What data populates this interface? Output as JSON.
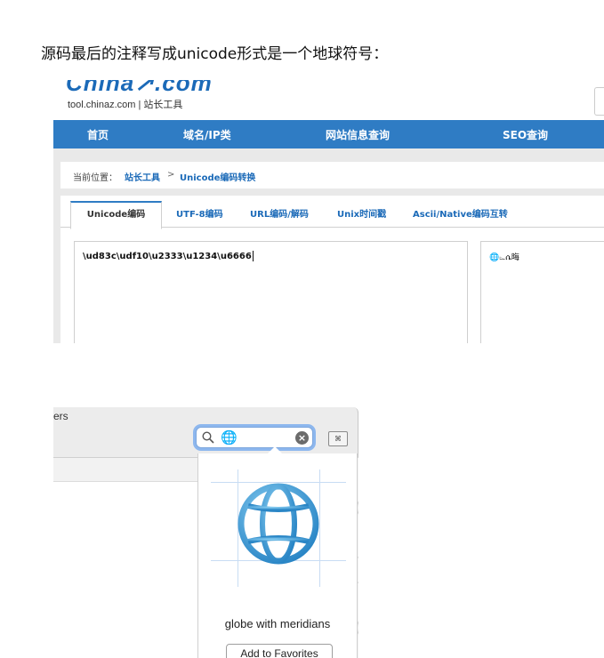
{
  "caption": "源码最后的注释写成unicode形式是一个地球符号：",
  "site": {
    "logo_text": "China↗.com",
    "logo_sub": "tool.chinaz.com | 站长工具",
    "nav": [
      "首页",
      "域名/IP类",
      "网站信息查询",
      "SEO查询"
    ],
    "breadcrumb": {
      "label": "当前位置：",
      "link1": "站长工具",
      "separator": ">",
      "link2": "Unicode编码转换"
    },
    "tabs": [
      {
        "label": "Unicode编码",
        "active": true
      },
      {
        "label": "UTF-8编码",
        "active": false
      },
      {
        "label": "URL编码/解码",
        "active": false
      },
      {
        "label": "Unix时间戳",
        "active": false
      },
      {
        "label": "Ascii/Native编码互转",
        "active": false
      }
    ],
    "input_value": "\\ud83c\\udf10\\u2333\\u1234\\u6666",
    "output_value": "🌐⌳ሴ晦"
  },
  "emoji_viewer": {
    "title_fragment": "ers",
    "search_value": "🌐",
    "clear_icon": "clear-icon",
    "keyboard_icon": "command-keyboard-icon",
    "keyboard_glyph": "⌘",
    "character_name": "globe with meridians",
    "favorites_button": "Add to Favorites",
    "globe_color": "#3a9bd5"
  }
}
